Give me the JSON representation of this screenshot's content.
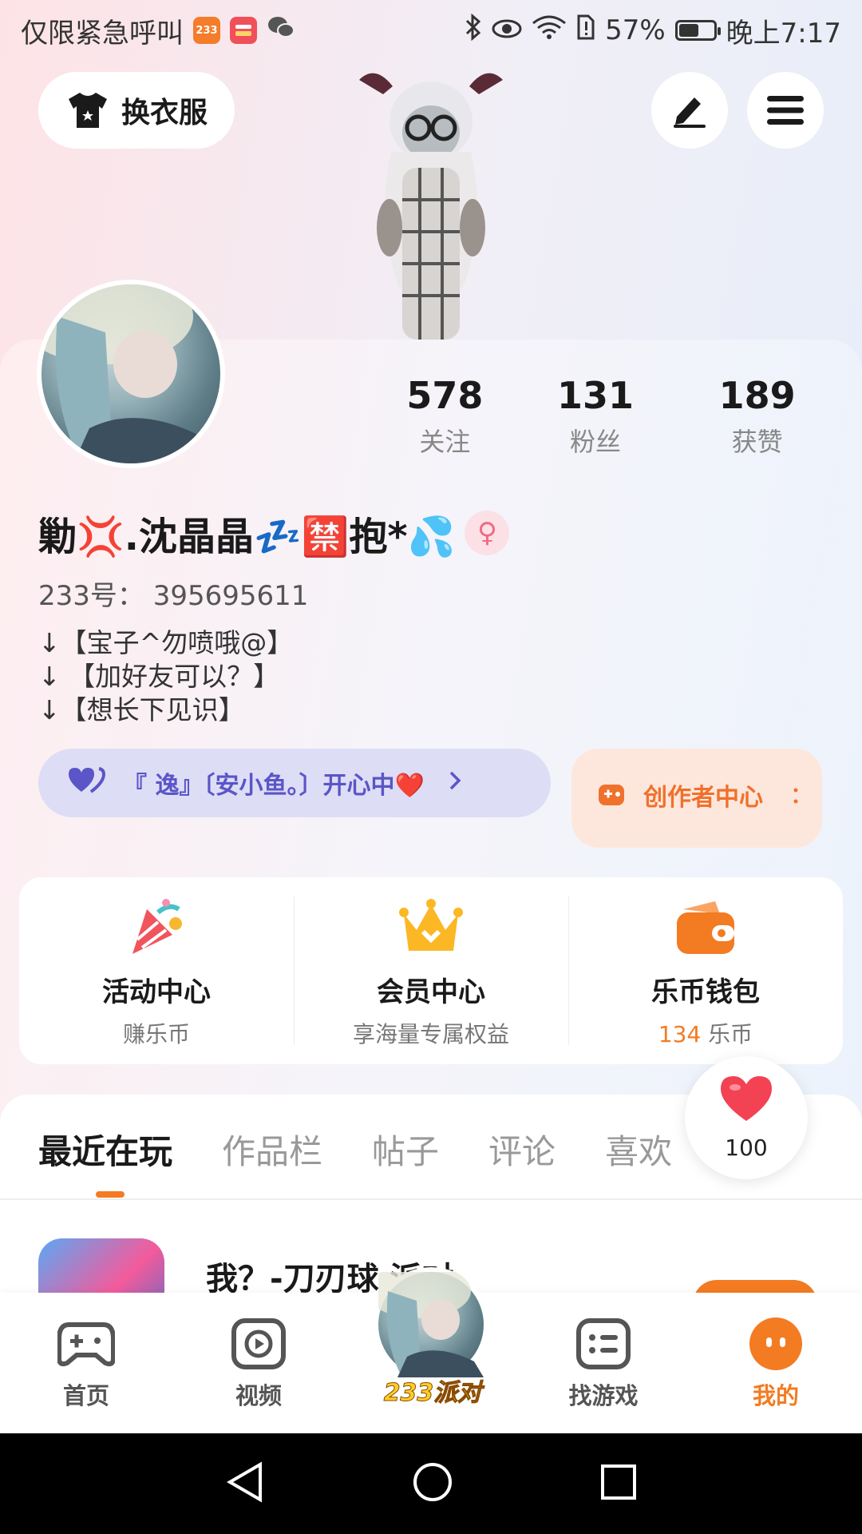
{
  "status_bar": {
    "carrier": "仅限紧急呼叫",
    "notification_badge": "233",
    "battery": "57%",
    "battery_level": 0.57,
    "time": "晚上7:17"
  },
  "header": {
    "outfit_label": "换衣服"
  },
  "stats": [
    {
      "value": "578",
      "label": "关注"
    },
    {
      "value": "131",
      "label": "粉丝"
    },
    {
      "value": "189",
      "label": "获赞"
    }
  ],
  "profile": {
    "nickname": "勦💢.沈晶晶💤🈲抱*💦",
    "user_id": "233号：  395695611",
    "bio": [
      "↓【宝子^勿喷哦@】",
      "↓ 【加好友可以？】",
      "↓【想长下见识】"
    ],
    "status_text": "『 逸』〔安小鱼。〕开心中❤️",
    "creator_label": "创作者中心"
  },
  "quick_menu": [
    {
      "title": "活动中心",
      "subtitle": "赚乐币"
    },
    {
      "title": "会员中心",
      "subtitle": "享海量专属权益"
    },
    {
      "title": "乐币钱包",
      "amount": "134",
      "unit": " 乐币"
    }
  ],
  "tabs": [
    "最近在玩",
    "作品栏",
    "帖子",
    "评论",
    "喜欢"
  ],
  "recent_game": {
    "title": "我？-刀刃球  派对"
  },
  "likes": {
    "count": "100"
  },
  "bottom_nav": [
    {
      "label": "首页"
    },
    {
      "label": "视频"
    },
    {
      "label": "233派对"
    },
    {
      "label": "找游戏"
    },
    {
      "label": "我的"
    }
  ],
  "colors": {
    "accent": "#f37b22",
    "status_pill": "#ddddf5",
    "creator_bg": "#fde7dc"
  }
}
